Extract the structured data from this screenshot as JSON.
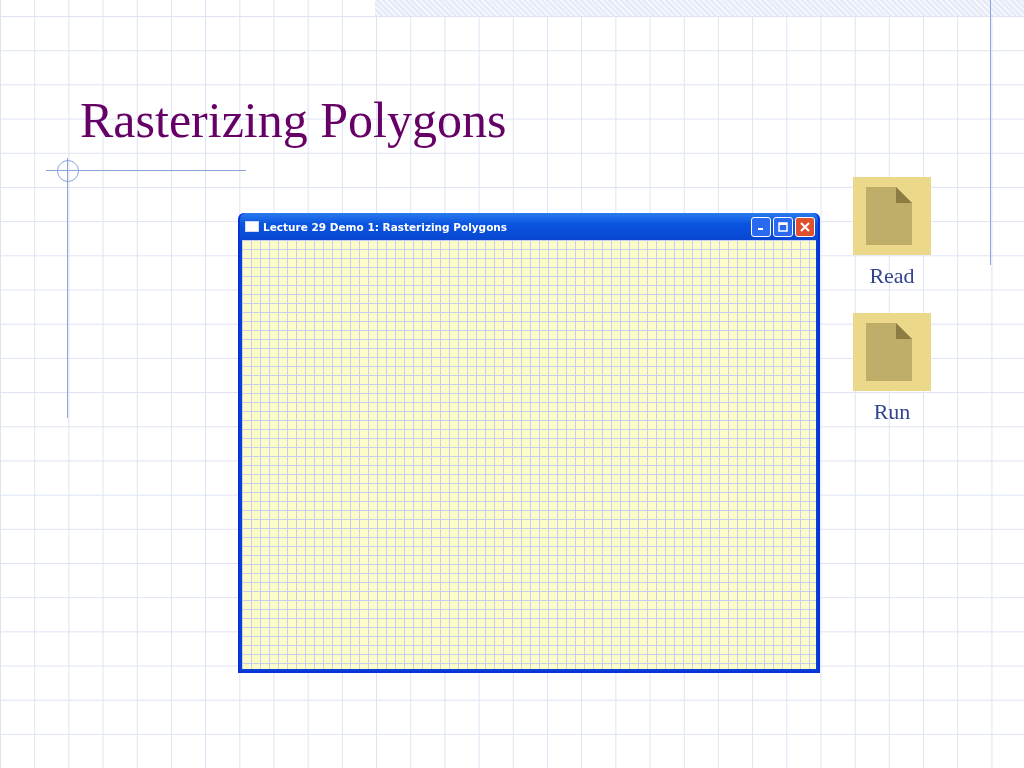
{
  "slide": {
    "title": "Rasterizing Polygons"
  },
  "window": {
    "title": "Lecture 29 Demo 1: Rasterizing Polygons"
  },
  "actions": [
    {
      "label": "Read"
    },
    {
      "label": "Run"
    }
  ]
}
